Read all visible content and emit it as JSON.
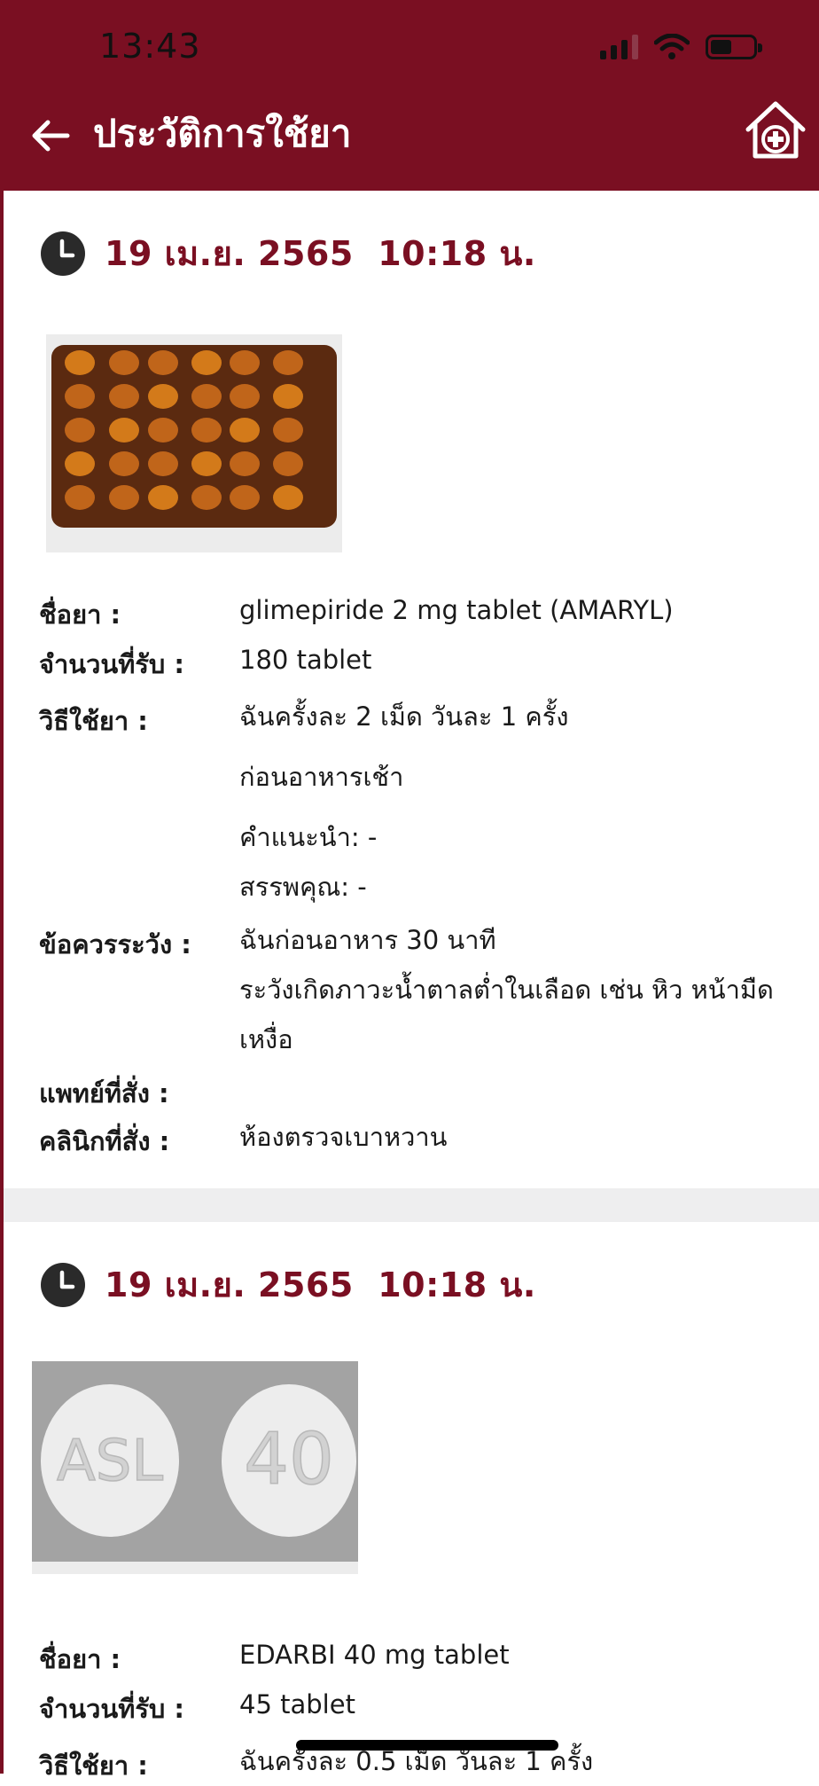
{
  "status_bar": {
    "time": "13:43"
  },
  "header": {
    "title": "ประวัติการใช้ยา"
  },
  "labels": {
    "drug_name": "ชื่อยา :",
    "quantity": "จำนวนที่รับ :",
    "usage": "วิธีใช้ยา :",
    "caution": "ข้อควรระวัง :",
    "doctor": "แพทย์ที่สั่ง :",
    "clinic": "คลินิกที่สั่ง :"
  },
  "records": [
    {
      "datetime": "19 เม.ย. 2565  10:18 น.",
      "drug_name": "glimepiride 2 mg tablet (AMARYL)",
      "quantity": "180 tablet",
      "usage_line1": "ฉันครั้งละ 2 เม็ด วันละ 1 ครั้ง",
      "usage_line2": " ก่อนอาหารเช้า",
      "advice": "คำแนะนำ: -",
      "property": "สรรพคุณ: -",
      "caution_line1": "ฉันก่อนอาหาร 30 นาที",
      "caution_line2": "ระวังเกิดภาวะน้ำตาลต่ำในเลือด เช่น หิว หน้ามืด",
      "caution_line3": "เหงื่อ",
      "doctor": "",
      "clinic": "ห้องตรวจเบาหวาน"
    },
    {
      "datetime": "19 เม.ย. 2565  10:18 น.",
      "drug_name": "EDARBI 40 mg tablet",
      "quantity": "45 tablet",
      "usage_line1": "ฉันครั้งละ 0.5 เม็ด วันละ 1 ครั้ง",
      "pill_imprint_left": "ASL",
      "pill_imprint_right": "40"
    }
  ],
  "icons": {
    "back": "arrow-left-icon",
    "home": "hospital-home-icon",
    "clock": "clock-icon"
  },
  "colors": {
    "header_bg": "#7a0f22",
    "accent": "#7a0f22",
    "divider": "#eeeeef"
  }
}
